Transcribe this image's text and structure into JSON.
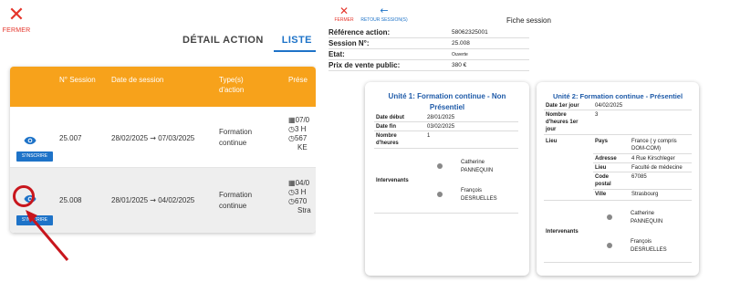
{
  "left_panel": {
    "close": {
      "icon": "close-icon",
      "label": "FERMER"
    },
    "tabs": [
      {
        "label": "DÉTAIL ACTION"
      },
      {
        "label": "LISTE"
      }
    ],
    "table": {
      "columns": [
        "N° Session",
        "Date de session",
        "Type(s) d'action",
        "Prése"
      ],
      "rows": [
        {
          "session": "25.007",
          "date_start": "28/02/2025",
          "date_end": "07/03/2025",
          "type_line1": "Formation",
          "type_line2": "continue",
          "details": [
            "07/0",
            "3 H",
            "567",
            "KE"
          ],
          "button": "S'INSCRIRE"
        },
        {
          "session": "25.008",
          "date_start": "28/01/2025",
          "date_end": "04/02/2025",
          "type_line1": "Formation",
          "type_line2": "continue",
          "details": [
            "04/0",
            "3 H",
            "670",
            "Stra"
          ],
          "button": "S'INSCRIRE"
        }
      ],
      "arrow_glyph": "→"
    },
    "annotation_color": "#c8161d"
  },
  "right_panel": {
    "close": {
      "icon": "close-icon",
      "label": "FERMER"
    },
    "back": {
      "icon": "back-arrow-icon",
      "label": "RETOUR SESSION(S)"
    },
    "title": "Fiche session",
    "info": [
      {
        "label": "Référence action:",
        "value": "58062325001"
      },
      {
        "label": "Session N°:",
        "value": "25.008"
      },
      {
        "label": "Etat:",
        "value": "Ouverte"
      },
      {
        "label": "Prix de vente public:",
        "value": "380 €"
      }
    ],
    "unit1": {
      "title_line1": "Unité 1: Formation continue - Non",
      "title_line2": "Présentiel",
      "date_debut_label": "Date début",
      "date_debut": "28/01/2025",
      "date_fin_label": "Date fin",
      "date_fin": "03/02/2025",
      "heures_label_1": "Nombre",
      "heures_label_2": "d'heures",
      "heures": "1",
      "intervenants_label": "Intervenants",
      "intervenants": [
        {
          "first": "Catherine",
          "last": "PANNEQUIN"
        },
        {
          "first": "François",
          "last": "DESRUELLES"
        }
      ]
    },
    "unit2": {
      "title": "Unité 2: Formation continue - Présentiel",
      "date_label": "Date 1er jour",
      "date": "04/02/2025",
      "heures_label_1": "Nombre",
      "heures_label_2": "d'heures 1er",
      "heures_label_3": "jour",
      "heures": "3",
      "lieu_label": "Lieu",
      "pays_label": "Pays",
      "pays_1": "France ( y compris",
      "pays_2": "DOM-COM)",
      "adresse_label": "Adresse",
      "adresse": "4 Rue Kirschleger",
      "lieu2_label": "Lieu",
      "lieu2": "Faculté de médecine",
      "code_label_1": "Code",
      "code_label_2": "postal",
      "code": "67085",
      "ville_label": "Ville",
      "ville": "Strasbourg",
      "intervenants_label": "Intervenants",
      "intervenants": [
        {
          "first": "Catherine",
          "last": "PANNEQUIN"
        },
        {
          "first": "François",
          "last": "DESRUELLES"
        }
      ]
    }
  },
  "colors": {
    "accent": "#1e73c8",
    "header": "#f7a21b",
    "danger": "#e5352b"
  }
}
